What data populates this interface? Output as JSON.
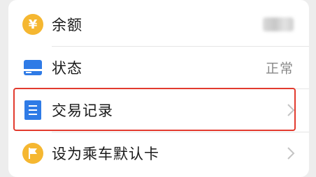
{
  "menu": {
    "items": [
      {
        "label": "余额",
        "value": "",
        "icon": "yuan-coin-icon",
        "chevron": false,
        "value_hidden": true
      },
      {
        "label": "状态",
        "value": "正常",
        "icon": "card-status-icon",
        "chevron": false
      },
      {
        "label": "交易记录",
        "value": "",
        "icon": "document-list-icon",
        "chevron": true
      },
      {
        "label": "设为乘车默认卡",
        "value": "",
        "icon": "flag-icon",
        "chevron": true
      }
    ]
  },
  "icons": {
    "yuan_symbol": "¥"
  },
  "colors": {
    "accent_yellow": "#f5b731",
    "accent_blue": "#2f7be6",
    "highlight_red": "#e23a2e",
    "chevron_gray": "#c4c4c4"
  }
}
